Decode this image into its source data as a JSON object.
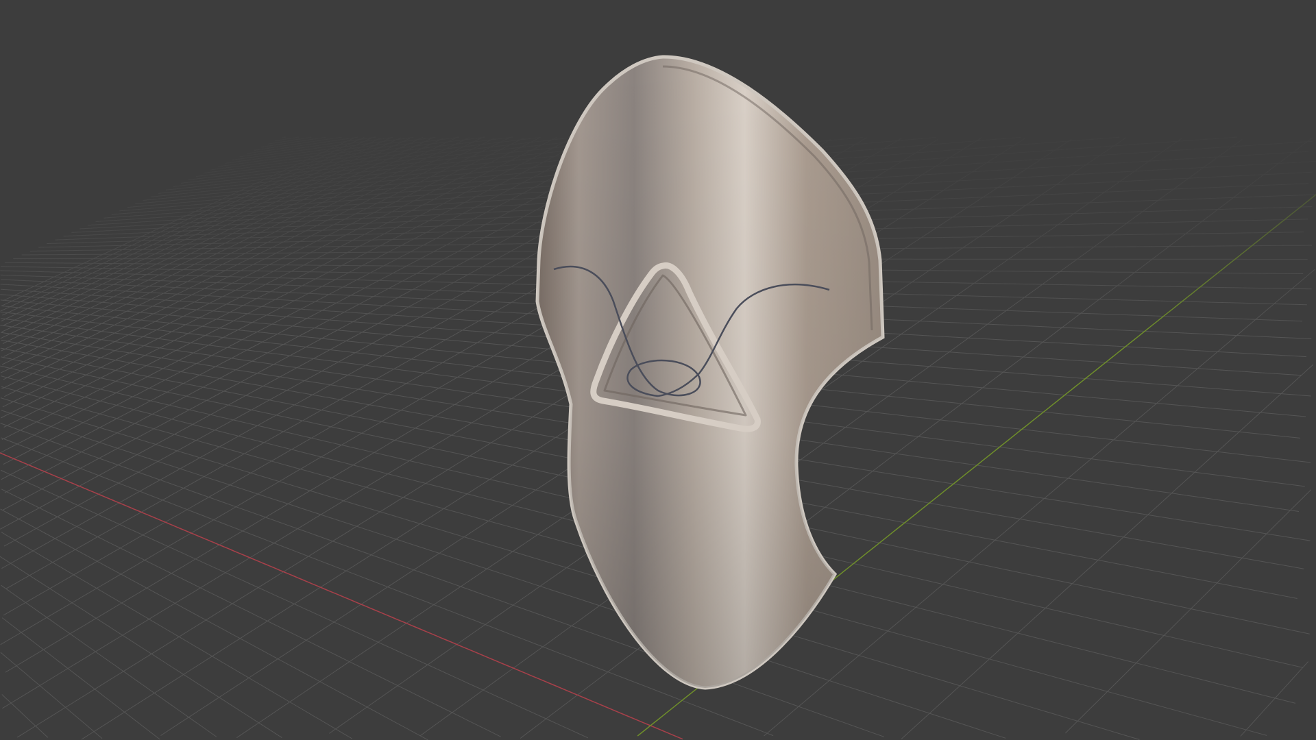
{
  "viewport": {
    "background": "#3d3d3d",
    "grid_color": "#555555",
    "x_axis_color": "#a8404a",
    "y_axis_color": "#6f8f2a",
    "material_colors": {
      "dark": "#7a6e66",
      "mid": "#9a9089",
      "light": "#d9d0c7",
      "rim": "#cfc8c0"
    }
  }
}
